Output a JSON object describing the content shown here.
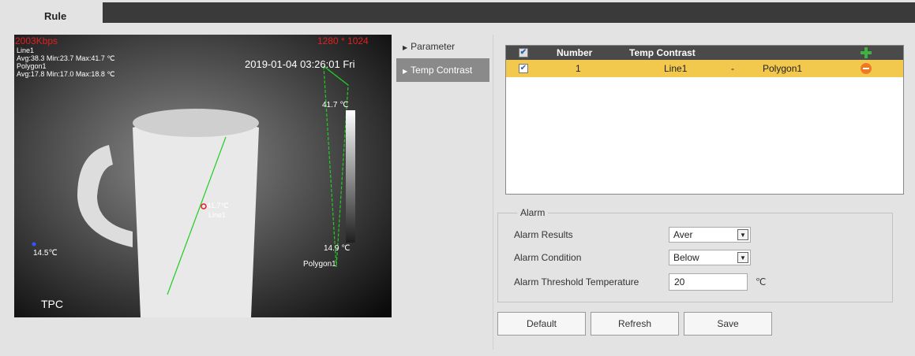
{
  "tabs": {
    "rule": "Rule"
  },
  "video": {
    "bitrate": "2003Kbps",
    "resolution": "1280 * 1024",
    "timestamp": "2019-01-04 03:26:01 Fri",
    "stats": [
      "Line1",
      "Avg:38.3 Min:23.7 Max:41.7 ℃",
      "Polygon1",
      "Avg:17.8 Min:17.0 Max:18.8 ℃"
    ],
    "scale_max": "41.7 ℃",
    "scale_min": "14.9 ℃",
    "left_temp": "14.5℃",
    "line_temp": "41.7℃",
    "line_label": "Line1",
    "polygon_label": "Polygon1",
    "channel": "TPC"
  },
  "menu": {
    "items": [
      {
        "label": "Parameter"
      },
      {
        "label": "Temp Contrast"
      }
    ]
  },
  "grid": {
    "headers": {
      "number": "Number",
      "temp_contrast": "Temp Contrast"
    },
    "rows": [
      {
        "number": "1",
        "rule_a": "Line1",
        "operator": "-",
        "rule_b": "Polygon1"
      }
    ]
  },
  "alarm": {
    "legend": "Alarm",
    "results_label": "Alarm Results",
    "results_value": "Aver",
    "condition_label": "Alarm Condition",
    "condition_value": "Below",
    "threshold_label": "Alarm Threshold Temperature",
    "threshold_value": "20",
    "threshold_unit": "℃"
  },
  "buttons": {
    "default": "Default",
    "refresh": "Refresh",
    "save": "Save"
  },
  "colors": {
    "row_highlight": "#f2c94c",
    "header_bg": "#4a4a4a",
    "active_menu": "#8a8a8a",
    "overlay_red": "#e02020",
    "rule_green": "#22cc22"
  }
}
